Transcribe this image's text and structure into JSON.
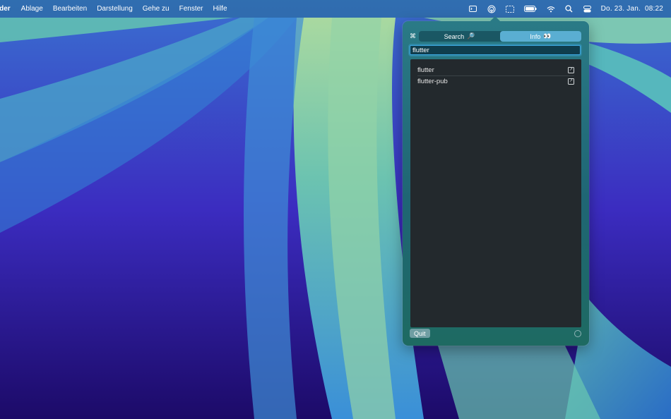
{
  "menubar": {
    "app_name": "nder",
    "menus": [
      "Ablage",
      "Bearbeiten",
      "Darstellung",
      "Gehe zu",
      "Fenster",
      "Hilfe"
    ],
    "status_icons": [
      "terminal-icon",
      "airdrop-icon",
      "screen-icon",
      "battery-icon",
      "wifi-icon",
      "search-icon",
      "control-center-icon"
    ],
    "date": "Do. 23. Jan.",
    "time": "08:22"
  },
  "popover": {
    "cmd_symbol": "⌘",
    "tabs": [
      {
        "label": "Search",
        "glyph": "🔎",
        "active": false
      },
      {
        "label": "Info",
        "glyph": "👀",
        "active": true
      }
    ],
    "search": {
      "value": "flutter"
    },
    "results": [
      "flutter",
      "flutter-pub"
    ],
    "quit_label": "Quit"
  },
  "colors": {
    "accent": "#5aaed2",
    "list_bg": "#23292d",
    "popover_bg": "#1f6674"
  }
}
